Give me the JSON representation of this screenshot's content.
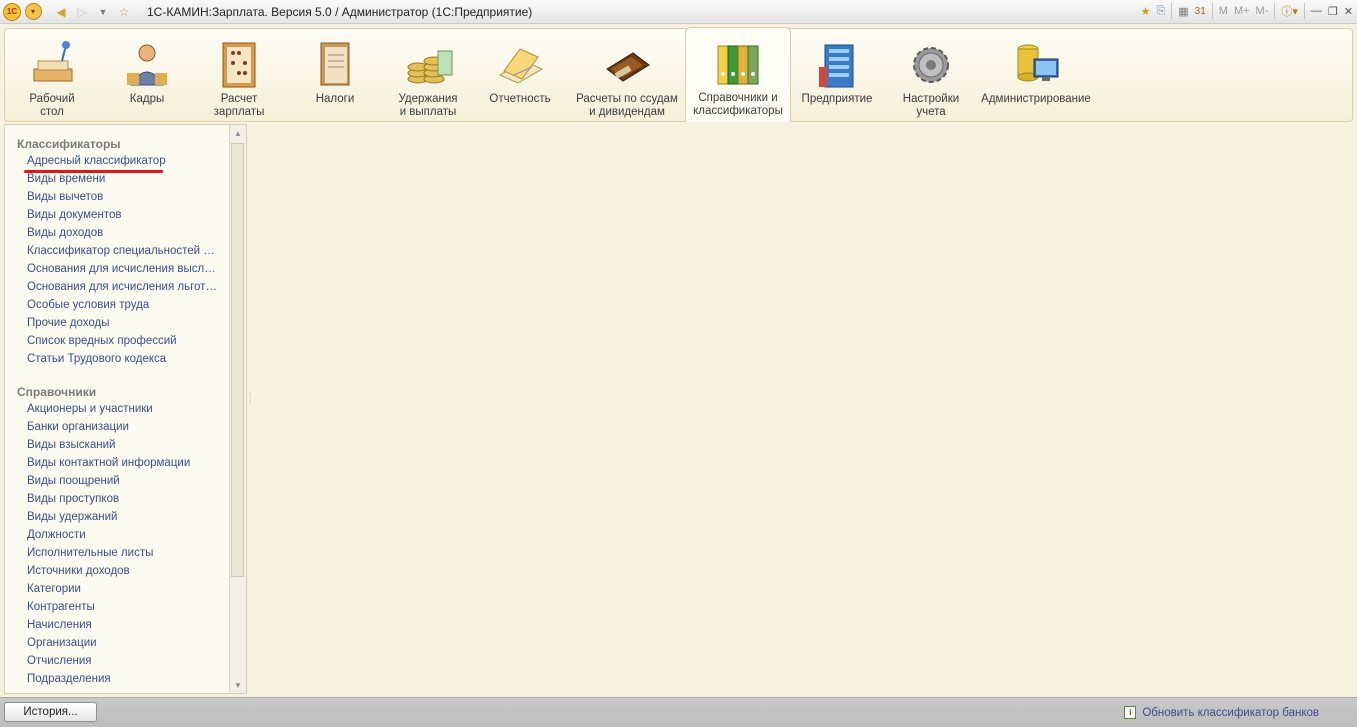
{
  "window": {
    "title": "1С-КАМИН:Зарплата. Версия 5.0 / Администратор  (1С:Предприятие)",
    "right_tools": [
      "M",
      "M+",
      "M-"
    ]
  },
  "sections": [
    {
      "label": "Рабочий\nстол",
      "icon": "desk-icon"
    },
    {
      "label": "Кадры",
      "icon": "person-icon"
    },
    {
      "label": "Расчет\nзарплаты",
      "icon": "abacus-icon"
    },
    {
      "label": "Налоги",
      "icon": "ledger-icon"
    },
    {
      "label": "Удержания\nи выплаты",
      "icon": "coins-icon"
    },
    {
      "label": "Отчетность",
      "icon": "report-icon"
    },
    {
      "label": "Расчеты по ссудам\nи дивидендам",
      "icon": "wallet-icon"
    },
    {
      "label": "Справочники и\nклассификаторы",
      "icon": "binders-icon"
    },
    {
      "label": "Предприятие",
      "icon": "building-icon"
    },
    {
      "label": "Настройки\nучета",
      "icon": "gear-icon"
    },
    {
      "label": "Администрирование",
      "icon": "admin-icon"
    }
  ],
  "nav": {
    "groups": [
      {
        "title": "Классификаторы",
        "items": [
          "Адресный классификатор",
          "Виды времени",
          "Виды вычетов",
          "Виды документов",
          "Виды доходов",
          "Классификатор специальностей по...",
          "Основания для исчисления выслуг...",
          "Основания для исчисления льготно...",
          "Особые условия труда",
          "Прочие доходы",
          "Список вредных профессий",
          "Статьи Трудового кодекса"
        ]
      },
      {
        "title": "Справочники",
        "items": [
          "Акционеры и участники",
          "Банки организации",
          "Виды взысканий",
          "Виды контактной информации",
          "Виды поощрений",
          "Виды проступков",
          "Виды удержаний",
          "Должности",
          "Исполнительные листы",
          "Источники доходов",
          "Категории",
          "Контрагенты",
          "Начисления",
          "Организации",
          "Отчисления",
          "Подразделения"
        ]
      }
    ]
  },
  "status": {
    "history_button": "История...",
    "link": "Обновить классификатор банков"
  },
  "colors": {
    "highlight": "#e0161a",
    "link": "#3d4c8c",
    "background": "#f6f2df"
  }
}
